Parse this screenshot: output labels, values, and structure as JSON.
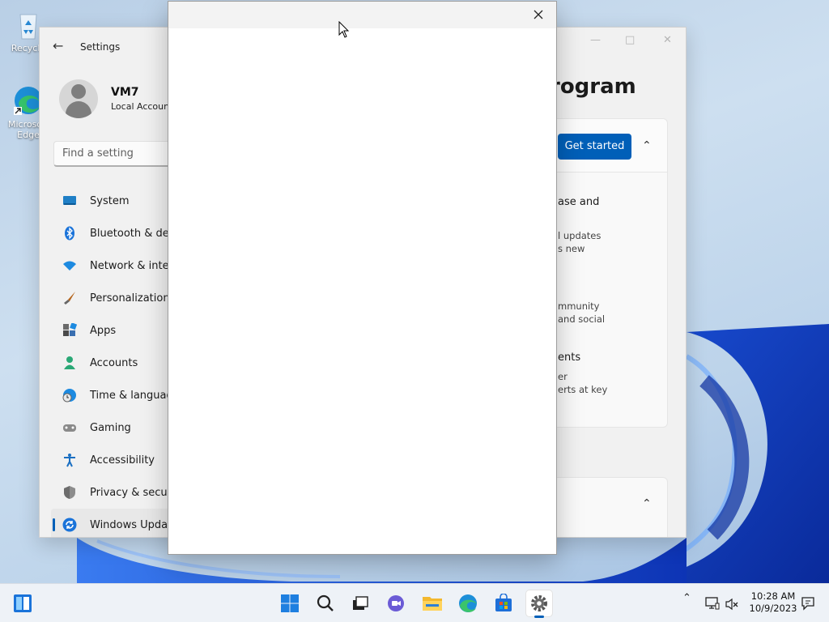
{
  "desktop": {
    "icons": [
      {
        "label": "Recycle"
      },
      {
        "label": "Microsoft Edge"
      }
    ]
  },
  "settings": {
    "title": "Settings",
    "profile": {
      "name": "VM7",
      "account_type": "Local Account"
    },
    "search_placeholder": "Find a setting",
    "nav": [
      {
        "label": "System",
        "icon": "system-icon"
      },
      {
        "label": "Bluetooth & devices",
        "icon": "bluetooth-icon"
      },
      {
        "label": "Network & internet",
        "icon": "wifi-icon"
      },
      {
        "label": "Personalization",
        "icon": "brush-icon"
      },
      {
        "label": "Apps",
        "icon": "apps-icon"
      },
      {
        "label": "Accounts",
        "icon": "person-icon"
      },
      {
        "label": "Time & language",
        "icon": "globe-clock-icon"
      },
      {
        "label": "Gaming",
        "icon": "gamepad-icon"
      },
      {
        "label": "Accessibility",
        "icon": "accessibility-icon"
      },
      {
        "label": "Privacy & security",
        "icon": "shield-icon"
      },
      {
        "label": "Windows Update",
        "icon": "update-icon",
        "active": true
      }
    ],
    "page_heading_partial": "rogram",
    "get_started_label": "Get started",
    "benefits_partial": [
      {
        "title": "ase and",
        "lines": []
      },
      {
        "title": "",
        "lines": [
          "l updates",
          "s new"
        ]
      },
      {
        "title": "",
        "lines": [
          "mmunity",
          "and social"
        ]
      },
      {
        "title": "ents",
        "lines": [
          "er",
          "erts at key"
        ]
      }
    ]
  },
  "taskbar": {
    "clock_time": "10:28 AM",
    "clock_date": "10/9/2023"
  },
  "colors": {
    "accent": "#005fb8"
  }
}
